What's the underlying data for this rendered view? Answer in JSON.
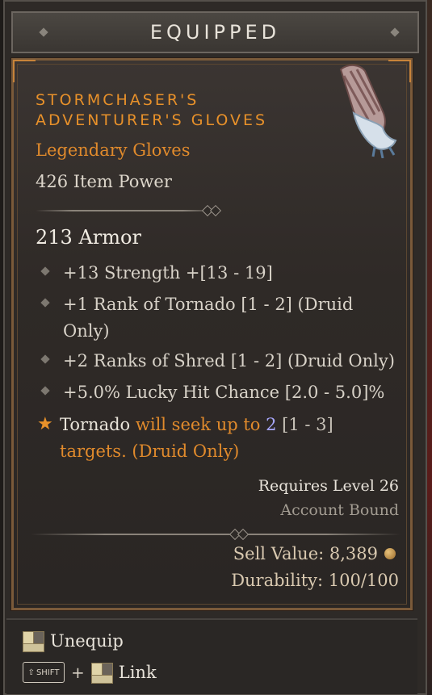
{
  "header": {
    "title": "EQUIPPED"
  },
  "item": {
    "name_line1": "STORMCHASER'S",
    "name_line2": "ADVENTURER'S GLOVES",
    "type": "Legendary Gloves",
    "item_power": "426 Item Power",
    "armor": "213 Armor",
    "icon": "gauntlet-icon",
    "affixes": [
      "+13 Strength +[13 - 19]",
      "+1 Rank of Tornado [1 - 2] (Druid Only)",
      "+2 Ranks of Shred [1 - 2] (Druid Only)",
      "+5.0% Lucky Hit Chance [2.0 - 5.0]%"
    ],
    "legendary_aspect": {
      "skill": "Tornado",
      "text_a": " will seek up to ",
      "value": "2",
      "range": " [1 - 3]",
      "text_b": " targets. (Druid Only)"
    },
    "requires_level": "Requires Level 26",
    "bound": "Account Bound",
    "sell_value": "Sell Value: 8,389",
    "durability": "Durability: 100/100"
  },
  "footer": {
    "unequip_label": "Unequip",
    "shift_label": "SHIFT",
    "plus": "+",
    "link_label": "Link"
  },
  "colors": {
    "legendary": "#e08a2c",
    "border": "#7a5a3a"
  }
}
